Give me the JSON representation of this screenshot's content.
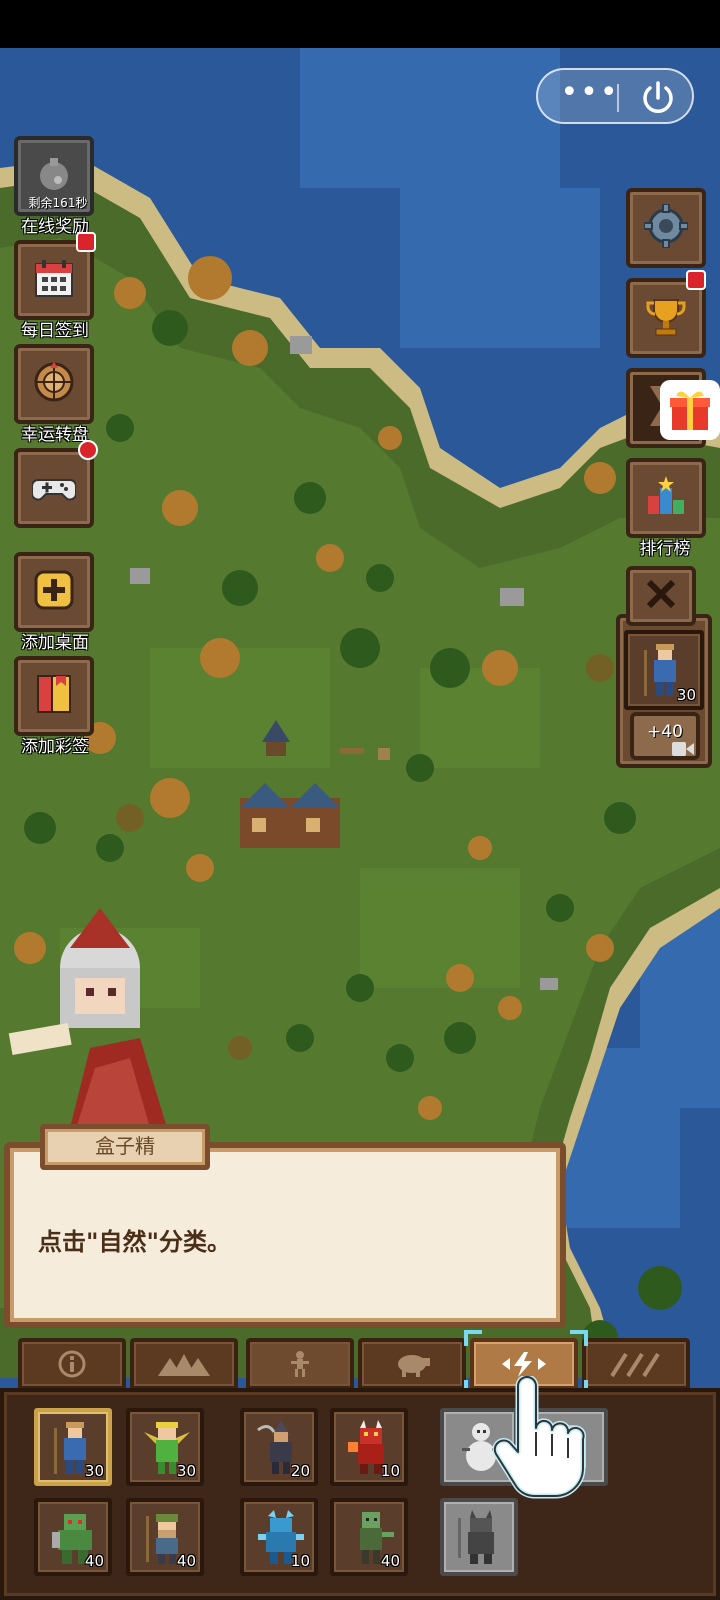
{
  "top_capsule": {
    "menu_glyph": "•••",
    "power_icon": "power-icon"
  },
  "left_menu": {
    "online_reward": {
      "timer": "剩余161秒",
      "label": "在线奖励",
      "icon": "bomb-bag-icon"
    },
    "daily_signin": {
      "label": "每日签到",
      "icon": "calendar-icon"
    },
    "lucky_wheel": {
      "label": "幸运转盘",
      "icon": "wheel-icon"
    },
    "games": {
      "icon": "gamepad-icon"
    },
    "add_desktop": {
      "label": "添加桌面",
      "icon": "plus-icon"
    },
    "add_tag": {
      "label": "添加彩签",
      "icon": "tag-icon"
    }
  },
  "right_menu": {
    "settings": {
      "icon": "gear-icon"
    },
    "trophy": {
      "icon": "trophy-icon"
    },
    "gift": {
      "icon": "gift-icon"
    },
    "ranking": {
      "label": "排行榜",
      "icon": "ranking-icon"
    },
    "close": {
      "icon": "close-icon"
    },
    "side_unit": {
      "count": "30",
      "ad_bonus": "+40"
    }
  },
  "dialog": {
    "speaker": "盒子精",
    "text": "点击\"自然\"分类。"
  },
  "category_tabs": [
    {
      "name": "info",
      "icon": "info-icon"
    },
    {
      "name": "terrain",
      "icon": "mountains-icon"
    },
    {
      "name": "creatures",
      "icon": "human-icon"
    },
    {
      "name": "animals",
      "icon": "sheep-icon"
    },
    {
      "name": "nature",
      "icon": "lightning-icon"
    },
    {
      "name": "tools",
      "icon": "tools-icon"
    }
  ],
  "units": [
    {
      "name": "farmer",
      "count": "30"
    },
    {
      "name": "elf",
      "count": "30"
    },
    {
      "name": "assassin",
      "count": "20"
    },
    {
      "name": "demon",
      "count": "10"
    },
    {
      "name": "snowman",
      "count": ""
    },
    {
      "name": "ghost",
      "count": ""
    },
    {
      "name": "orc",
      "count": "40"
    },
    {
      "name": "dwarf",
      "count": "40"
    },
    {
      "name": "ice-creature",
      "count": "10"
    },
    {
      "name": "zombie",
      "count": "40"
    },
    {
      "name": "devil",
      "count": ""
    }
  ],
  "colors": {
    "ocean": "#2f5f9e",
    "land": "#4a6b2a",
    "panel": "#3e2718",
    "dialog_bg": "#f5ecdc"
  }
}
